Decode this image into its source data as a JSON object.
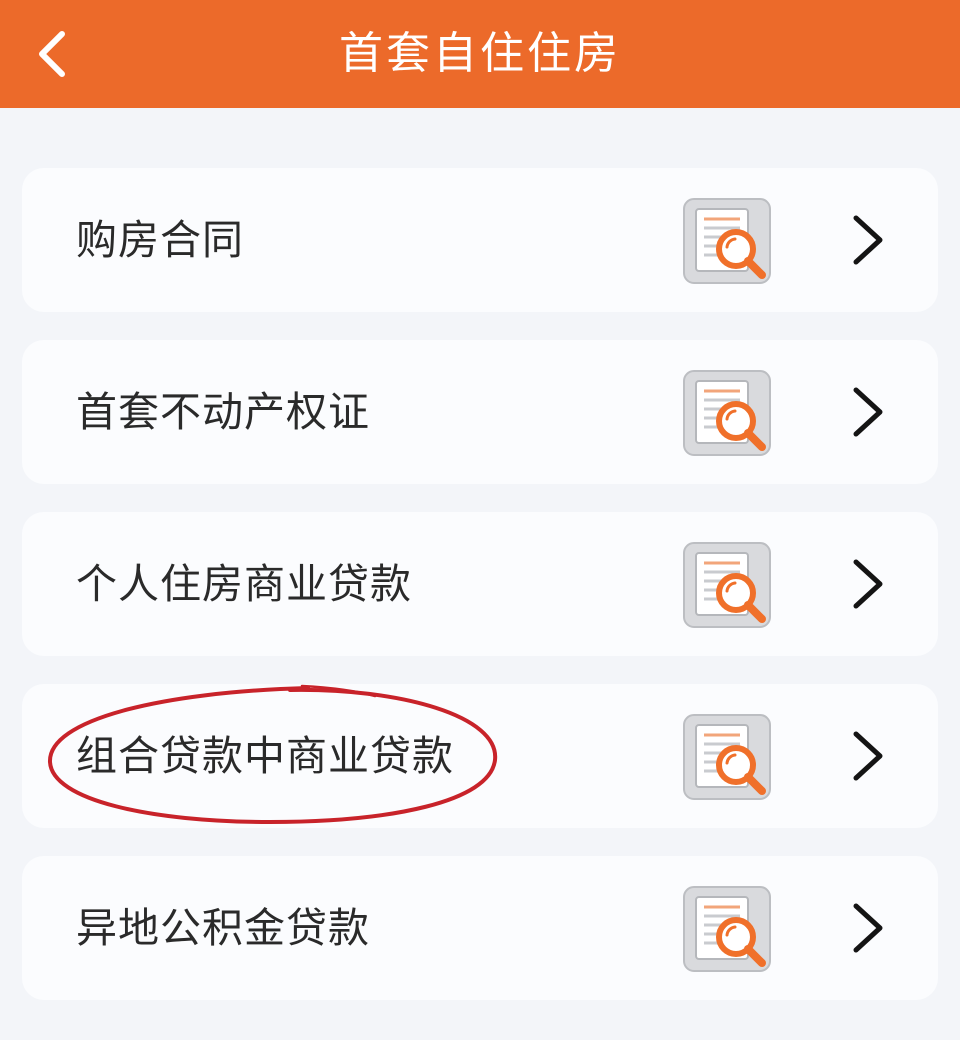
{
  "header": {
    "title": "首套自住住房",
    "back_icon": "chevron-left-icon"
  },
  "items": [
    {
      "label": "购房合同",
      "icon": "document-search-icon",
      "arrow": "chevron-right-icon"
    },
    {
      "label": "首套不动产权证",
      "icon": "document-search-icon",
      "arrow": "chevron-right-icon"
    },
    {
      "label": "个人住房商业贷款",
      "icon": "document-search-icon",
      "arrow": "chevron-right-icon"
    },
    {
      "label": "组合贷款中商业贷款",
      "icon": "document-search-icon",
      "arrow": "chevron-right-icon",
      "highlighted": true
    },
    {
      "label": "异地公积金贷款",
      "icon": "document-search-icon",
      "arrow": "chevron-right-icon"
    }
  ],
  "colors": {
    "header_bg": "#ec6a2a",
    "page_bg": "#f3f5f9",
    "card_bg": "#fbfcfe",
    "icon_accent": "#f0702a",
    "highlight_ring": "#c8232a"
  }
}
